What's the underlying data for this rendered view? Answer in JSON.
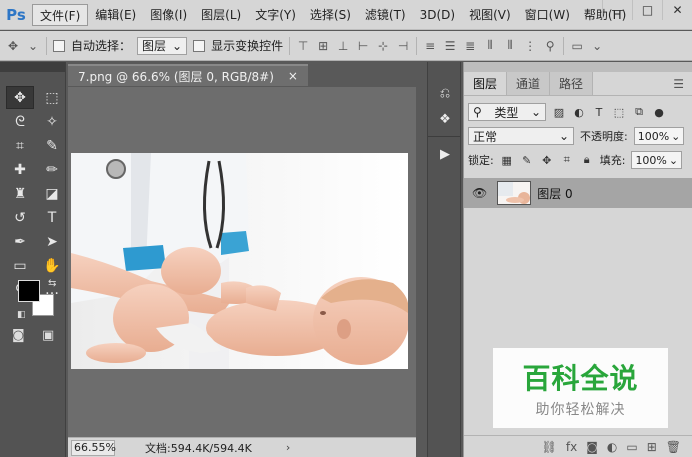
{
  "app": {
    "logo": "Ps"
  },
  "menu": {
    "items": [
      "文件(F)",
      "编辑(E)",
      "图像(I)",
      "图层(L)",
      "文字(Y)",
      "选择(S)",
      "滤镜(T)",
      "3D(D)",
      "视图(V)",
      "窗口(W)",
      "帮助(H)"
    ],
    "active_index": 0
  },
  "window_controls": {
    "minimize": "—",
    "maximize": "□",
    "close": "✕"
  },
  "options_bar": {
    "auto_select_label": "自动选择：",
    "auto_select_target": "图层",
    "show_transform_label": "显示变换控件"
  },
  "document": {
    "tab_title": "7.png @ 66.6% (图层 0, RGB/8#)",
    "tab_close": "×"
  },
  "status_bar": {
    "zoom": "66.55%",
    "doc_info": "文档:594.4K/594.4K",
    "arrow": "›"
  },
  "layers_panel": {
    "tabs": [
      "图层",
      "通道",
      "路径"
    ],
    "active_tab": 0,
    "filter_label": "类型",
    "blend_mode": "正常",
    "opacity_label": "不透明度:",
    "opacity_value": "100%",
    "lock_label": "锁定:",
    "fill_label": "填充:",
    "fill_value": "100%",
    "layers": [
      {
        "name": "图层 0",
        "visible": true
      }
    ]
  },
  "watermark": {
    "title": "百科全说",
    "subtitle": "助你轻松解决"
  },
  "colors": {
    "foreground": "#000000",
    "background": "#ffffff",
    "workspace": "#6d6d6d",
    "panel": "#d6d6d6",
    "watermark_green": "#29a63b"
  }
}
